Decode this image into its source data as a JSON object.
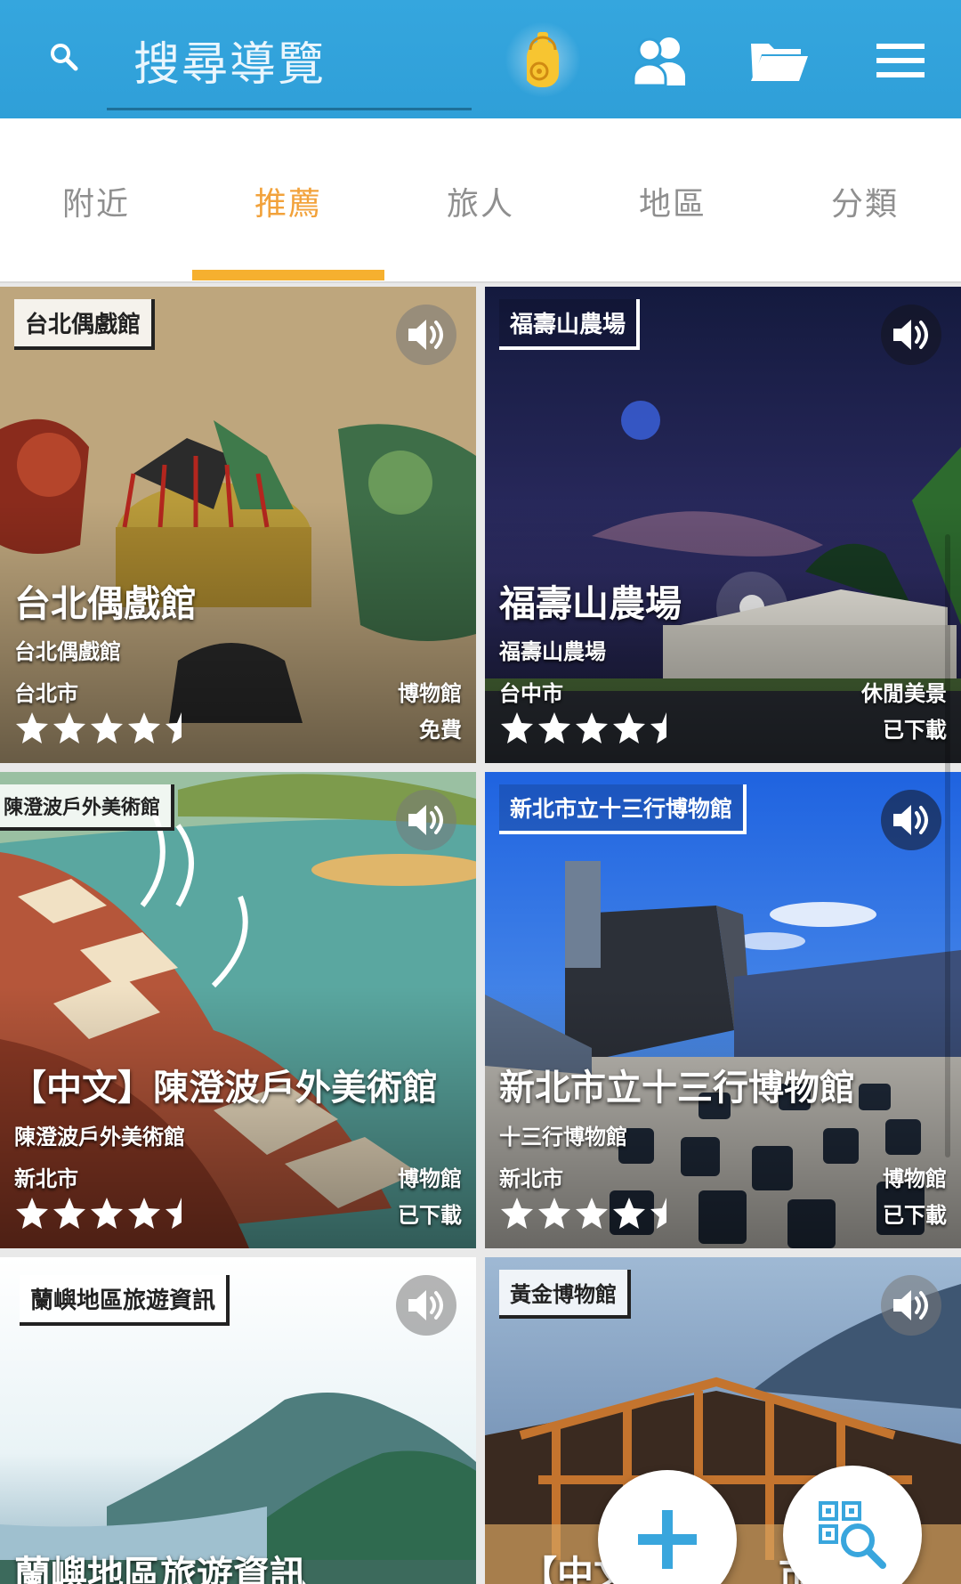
{
  "header": {
    "search_placeholder": "搜尋導覽",
    "icons": [
      "search-icon",
      "headphones-guide-icon",
      "people-icon",
      "folder-icon",
      "menu-icon"
    ],
    "bar_color": "#2f9fd8",
    "headphones_color": "#f7c531"
  },
  "tabs": [
    {
      "label": "附近",
      "active": false
    },
    {
      "label": "推薦",
      "active": true
    },
    {
      "label": "旅人",
      "active": false
    },
    {
      "label": "地區",
      "active": false
    },
    {
      "label": "分類",
      "active": false
    }
  ],
  "accent_color": "#f6b02f",
  "cards": [
    {
      "stamp": "台北偶戲館",
      "title": "台北偶戲館",
      "subtitle": "台北偶戲館",
      "city": "台北市",
      "category": "博物館",
      "status": "免費",
      "rating": 4.5
    },
    {
      "stamp": "福壽山農場",
      "title": "福壽山農場",
      "subtitle": "福壽山農場",
      "city": "台中市",
      "category": "休閒美景",
      "status": "已下載",
      "rating": 4.5
    },
    {
      "stamp": "陳澄波戶外美術館",
      "title": "【中文】陳澄波戶外美術館",
      "subtitle": "陳澄波戶外美術館",
      "city": "新北市",
      "category": "博物館",
      "status": "已下載",
      "rating": 4.5
    },
    {
      "stamp": "新北市立十三行博物館",
      "title": "新北市立十三行博物館",
      "subtitle": "十三行博物館",
      "city": "新北市",
      "category": "博物館",
      "status": "已下載",
      "rating": 4.5
    },
    {
      "stamp": "蘭嶼地區旅遊資訊",
      "title": "蘭嶼地區旅遊資訊",
      "subtitle": "",
      "city": "",
      "category": "",
      "status": "",
      "rating": null
    },
    {
      "stamp": "黃金博物館",
      "title": "【中文",
      "title_tail": "市立",
      "subtitle": "",
      "city": "",
      "category": "",
      "status": "",
      "rating": null
    }
  ],
  "fabs": {
    "add_icon": "plus-icon",
    "scan_icon": "qr-search-icon",
    "plus_color": "#39a6dd"
  }
}
